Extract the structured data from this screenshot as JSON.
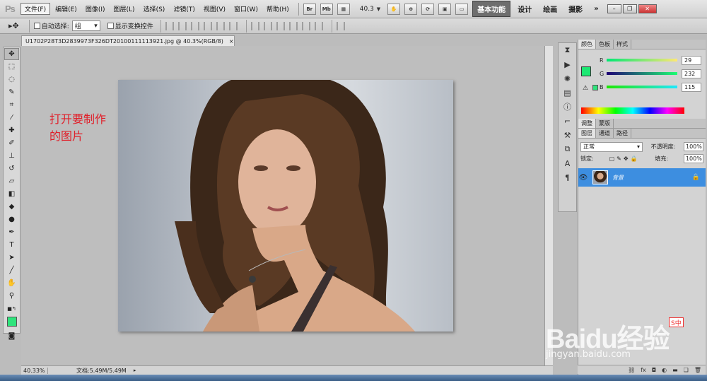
{
  "app": {
    "logo": "Ps"
  },
  "menu": [
    "文件(F)",
    "编辑(E)",
    "图像(I)",
    "图层(L)",
    "选择(S)",
    "滤镜(T)",
    "视图(V)",
    "窗口(W)",
    "帮助(H)"
  ],
  "toolbar": {
    "btn_br": "Br",
    "btn_mb": "Mb",
    "zoom": "40.3"
  },
  "workspaces": [
    "基本功能",
    "设计",
    "绘画",
    "摄影"
  ],
  "workspace_more": "»",
  "options": {
    "auto_select": "自动选择:",
    "group": "组",
    "show_transform": "显示变换控件"
  },
  "document": {
    "tab_title": "U1702P28T3D2839973F326DT20100111113921.jpg @ 40.3%(RGB/8)",
    "close": "×"
  },
  "annotation": {
    "line1": "打开要制作",
    "line2": "的图片"
  },
  "status": {
    "zoom": "40.33%",
    "doc_size": "文档:5.49M/5.49M"
  },
  "color_panel": {
    "tabs": [
      "颜色",
      "色板",
      "样式"
    ],
    "r_label": "R",
    "g_label": "G",
    "b_label": "B",
    "r": "29",
    "g": "232",
    "b": "115",
    "foreground": "#1de873"
  },
  "adjust_tabs": [
    "调整",
    "蒙版"
  ],
  "layers_panel": {
    "tabs": [
      "图层",
      "通道",
      "路径"
    ],
    "blend_mode": "正常",
    "opacity_label": "不透明度:",
    "opacity": "100%",
    "lock_label": "锁定:",
    "fill_label": "填充:",
    "fill": "100%",
    "layer_name": "背景"
  },
  "watermark": {
    "brand": "Baidu经验",
    "url": "jingyan.baidu.com"
  },
  "ime": {
    "label": "S中"
  },
  "colors": {
    "accent_blue": "#3d8ee0",
    "annotation": "#e0202a"
  }
}
